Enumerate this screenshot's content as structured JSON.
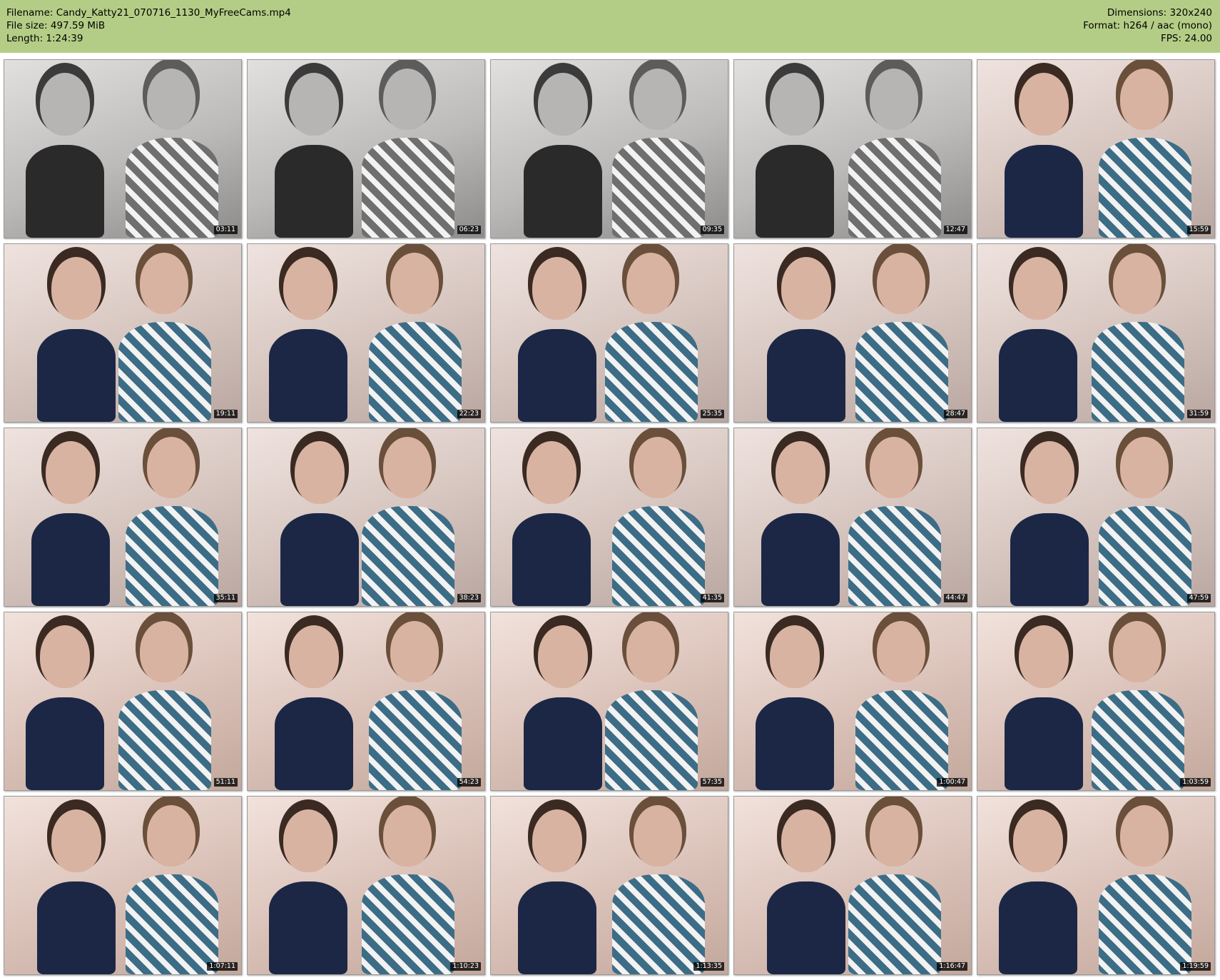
{
  "header": {
    "filename": "Filename: Candy_Katty21_070716_1130_MyFreeCams.mp4",
    "filesize": "File size: 497.59 MiB",
    "length": "Length: 1:24:39",
    "dimensions": "Dimensions: 320x240",
    "format": "Format: h264 / aac (mono)",
    "fps": "FPS: 24.00"
  },
  "colors": {
    "header_bg": "#b4cd86",
    "timestamp_bg": "#000000",
    "timestamp_text": "#ffffff"
  },
  "thumbnails": [
    {
      "time": "03:11",
      "tone": "gray"
    },
    {
      "time": "06:23",
      "tone": "gray"
    },
    {
      "time": "09:35",
      "tone": "gray"
    },
    {
      "time": "12:47",
      "tone": "gray"
    },
    {
      "time": "15:59",
      "tone": "color"
    },
    {
      "time": "19:11",
      "tone": "color"
    },
    {
      "time": "22:23",
      "tone": "color"
    },
    {
      "time": "25:35",
      "tone": "color"
    },
    {
      "time": "28:47",
      "tone": "color"
    },
    {
      "time": "31:59",
      "tone": "color"
    },
    {
      "time": "35:11",
      "tone": "color"
    },
    {
      "time": "38:23",
      "tone": "color"
    },
    {
      "time": "41:35",
      "tone": "color"
    },
    {
      "time": "44:47",
      "tone": "color"
    },
    {
      "time": "47:59",
      "tone": "color"
    },
    {
      "time": "51:11",
      "tone": "warm"
    },
    {
      "time": "54:23",
      "tone": "warm"
    },
    {
      "time": "57:35",
      "tone": "warm"
    },
    {
      "time": "1:00:47",
      "tone": "warm"
    },
    {
      "time": "1:03:59",
      "tone": "warm"
    },
    {
      "time": "1:07:11",
      "tone": "warm"
    },
    {
      "time": "1:10:23",
      "tone": "warm"
    },
    {
      "time": "1:13:35",
      "tone": "warm"
    },
    {
      "time": "1:16:47",
      "tone": "warm"
    },
    {
      "time": "1:19:59",
      "tone": "warm"
    }
  ]
}
